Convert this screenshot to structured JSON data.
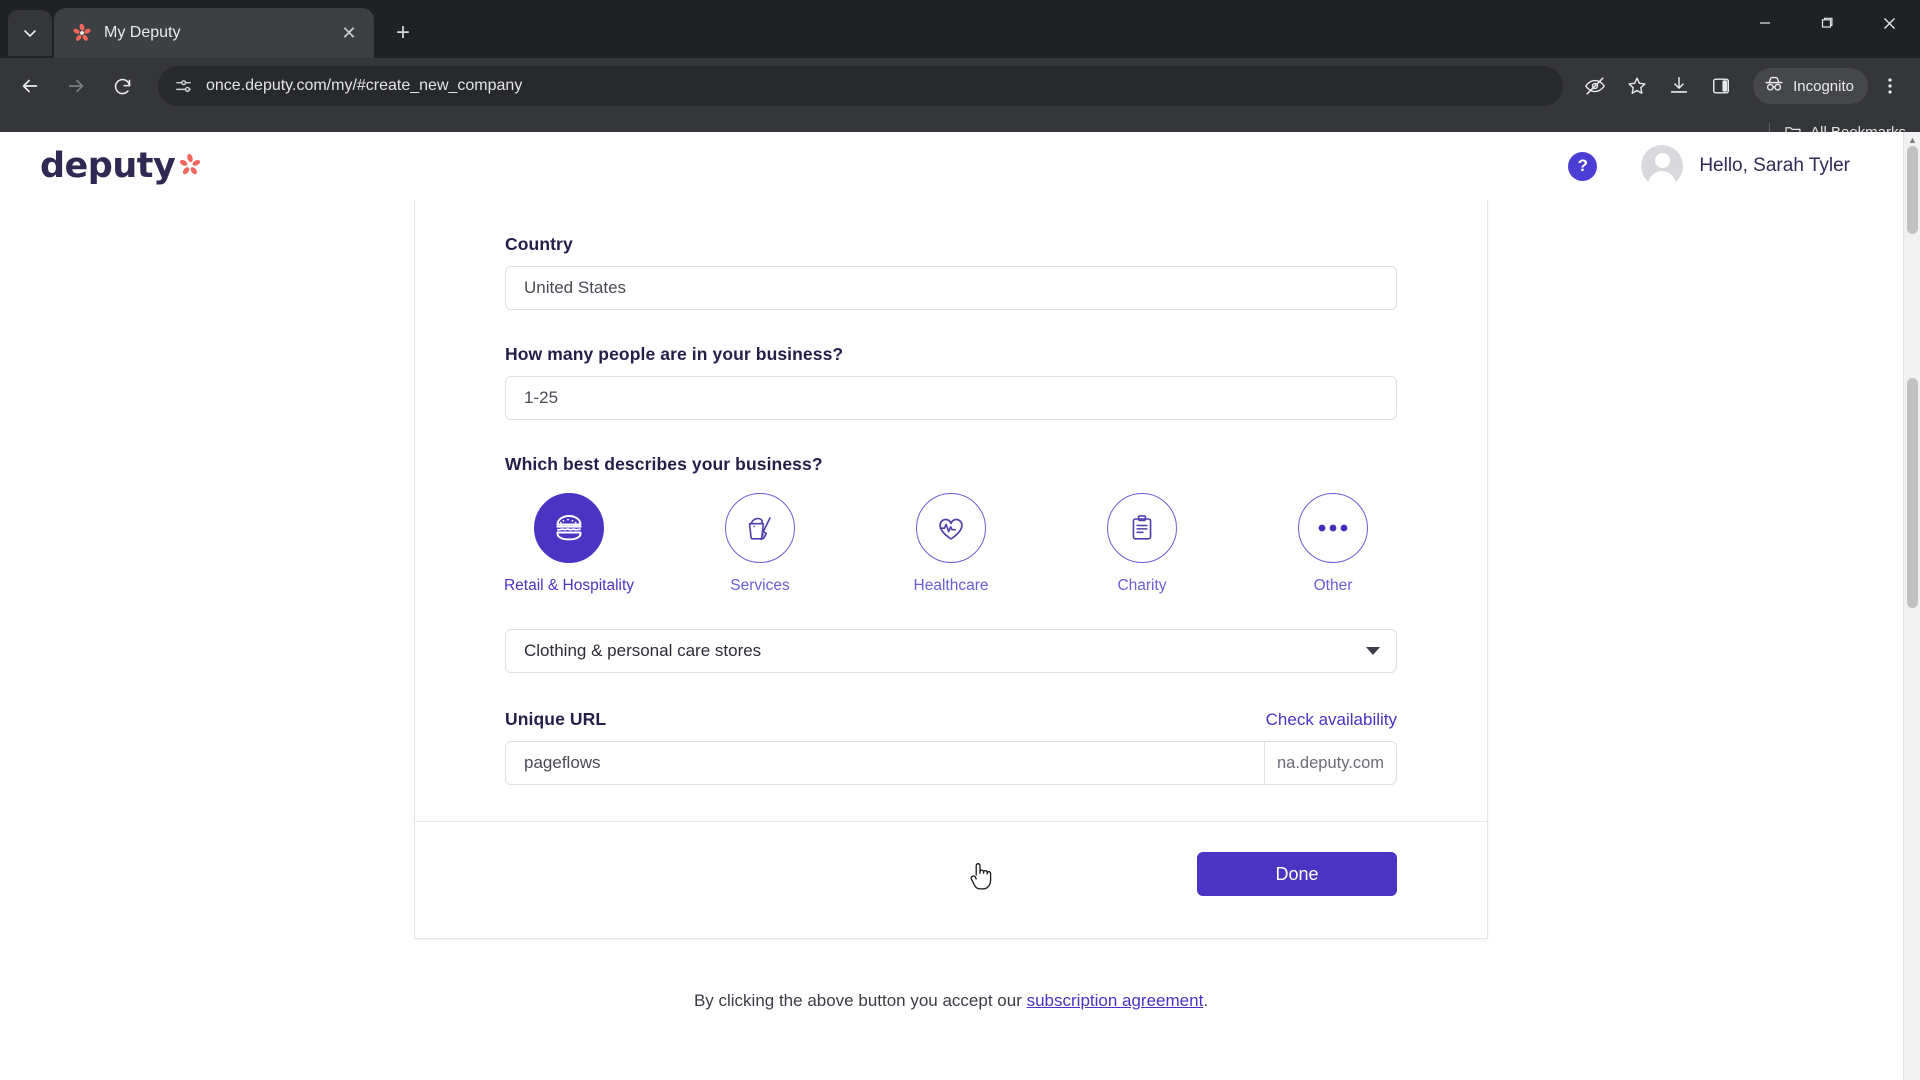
{
  "browser": {
    "tab": {
      "title": "My Deputy",
      "favicon_icon": "deputy-star-icon",
      "close_icon": "close-icon"
    },
    "tab_search_icon": "tab-search-chevron-icon",
    "new_tab_label": "+",
    "window_controls": {
      "minimize": "—",
      "maximize": "❐",
      "close": "✕"
    },
    "nav": {
      "back_icon": "back-arrow-icon",
      "forward_icon": "forward-arrow-icon",
      "reload_icon": "reload-icon"
    },
    "omnibox": {
      "url": "once.deputy.com/my/#create_new_company",
      "site_info_icon": "site-settings-icon"
    },
    "actions": {
      "tracking_protection_icon": "eye-off-icon",
      "bookmark_icon": "star-icon",
      "downloads_icon": "download-icon",
      "side_panel_icon": "side-panel-icon",
      "menu_icon": "three-dot-menu-icon"
    },
    "incognito": {
      "label": "Incognito",
      "icon": "incognito-hat-icon"
    },
    "bookmarks": {
      "all_label": "All Bookmarks",
      "folder_icon": "folder-icon"
    }
  },
  "app": {
    "logo_word": "deputy",
    "logo_star_icon": "deputy-star-icon",
    "help_label": "?",
    "avatar_icon": "user-avatar-icon",
    "greeting": "Hello, Sarah Tyler"
  },
  "form": {
    "country": {
      "label": "Country",
      "value": "United States"
    },
    "people": {
      "label": "How many people are in your business?",
      "value": "1-25"
    },
    "business_type": {
      "label": "Which best describes your business?",
      "options": [
        {
          "label": "Retail & Hospitality",
          "icon": "burger-icon",
          "selected": true
        },
        {
          "label": "Services",
          "icon": "mop-bucket-icon",
          "selected": false
        },
        {
          "label": "Healthcare",
          "icon": "heart-pulse-icon",
          "selected": false
        },
        {
          "label": "Charity",
          "icon": "clipboard-icon",
          "selected": false
        },
        {
          "label": "Other",
          "icon": "ellipsis-icon",
          "selected": false
        }
      ]
    },
    "industry_select": {
      "value": "Clothing & personal care stores",
      "caret_icon": "chevron-down-icon"
    },
    "unique_url": {
      "label": "Unique URL",
      "check_link": "Check availability",
      "value": "pageflows",
      "suffix": "na.deputy.com"
    },
    "submit": {
      "label": "Done"
    },
    "legal": {
      "prefix": "By clicking the above button you accept our ",
      "link": "subscription agreement",
      "suffix": "."
    }
  },
  "colors": {
    "brand_purple": "#4b33c4",
    "brand_purple_light": "#6a5fd4",
    "logo_navy": "#2f2a54",
    "logo_coral": "#f2665e",
    "chrome_dark": "#35363a"
  }
}
